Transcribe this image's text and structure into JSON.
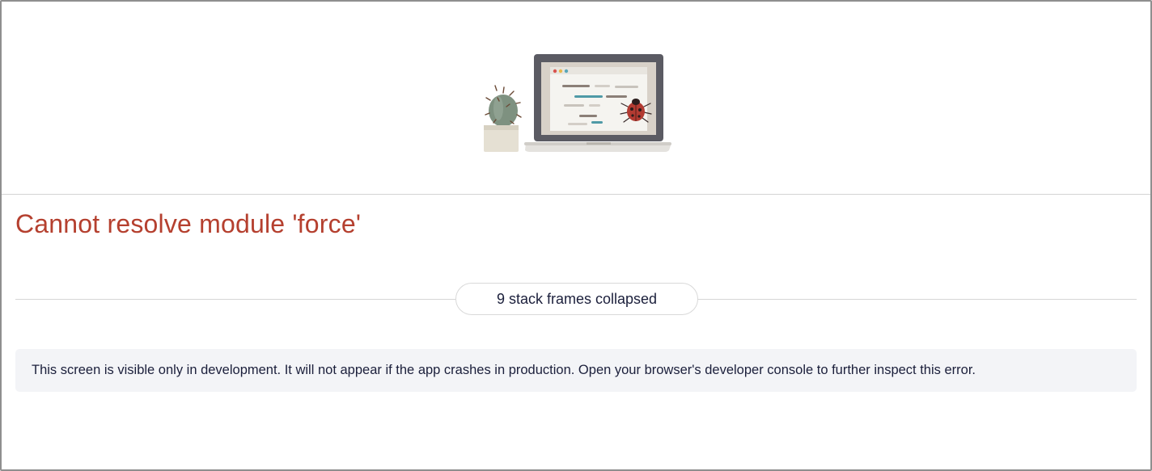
{
  "error": {
    "title": "Cannot resolve module 'force'"
  },
  "stack": {
    "collapsed_label": "9 stack frames collapsed"
  },
  "notice": {
    "text": "This screen is visible only in development. It will not appear if the app crashes in production. Open your browser's developer console to further inspect this error."
  },
  "illustration": {
    "icons": [
      "cactus-icon",
      "laptop-icon",
      "ladybug-icon"
    ]
  },
  "colors": {
    "error_title": "#b5402f",
    "body_text": "#1b1f3b",
    "notice_background": "#f3f4f7",
    "divider": "#d4d4d4"
  }
}
